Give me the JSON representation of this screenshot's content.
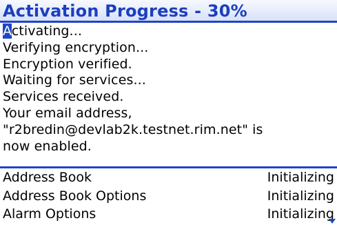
{
  "title": "Activation Progress - 30%",
  "log": {
    "first_char": "A",
    "first_rest": "ctivating...",
    "lines": [
      "Verifying encryption...",
      "Encryption verified.",
      "Waiting for services...",
      "Services received.",
      "Your email address,",
      "\"r2bredin@devlab2k.testnet.rim.net\" is",
      "now enabled."
    ]
  },
  "apps": [
    {
      "name": "Address Book",
      "status": "Initializing"
    },
    {
      "name": "Address Book Options",
      "status": "Initializing"
    },
    {
      "name": "Alarm Options",
      "status": "Initializing"
    }
  ],
  "progress": {
    "percent": 30
  },
  "colors": {
    "accent": "#1f45c8",
    "title_text": "#1b3fbf",
    "background": "#ffffff",
    "text": "#000000"
  },
  "icons": {
    "scroll_down": "scroll-down-arrow-icon"
  }
}
